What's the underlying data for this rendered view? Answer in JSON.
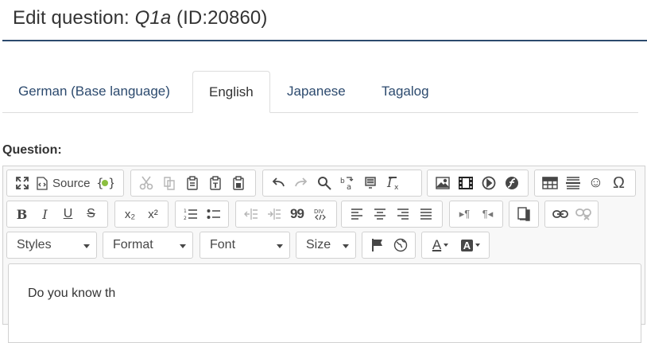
{
  "header": {
    "title_prefix": "Edit question: ",
    "question_code": "Q1a",
    "question_id": " (ID:20860)"
  },
  "tabs": [
    {
      "label": "German (Base language)",
      "active": false
    },
    {
      "label": "English",
      "active": true
    },
    {
      "label": "Japanese",
      "active": false
    },
    {
      "label": "Tagalog",
      "active": false
    }
  ],
  "question_label": "Question:",
  "editor": {
    "source_label": "Source",
    "combos": {
      "styles": "Styles",
      "format": "Format",
      "font": "Font",
      "size": "Size"
    },
    "glyphs": {
      "bold": "B",
      "italic": "I",
      "underline": "U",
      "strike": "S",
      "subscript": "x₂",
      "superscript": "x²",
      "blockquote": "99",
      "div": "DIV",
      "special_char": "Ω",
      "smiley": "☺",
      "ltr": "▸¶",
      "rtl": "¶◂",
      "text_color": "A",
      "bg_color": "A"
    },
    "content_text": "Do you know th"
  },
  "colors": {
    "accent": "#2c4a6e",
    "border": "#d1d1d1",
    "toolbar_bg": "#f8f8f8",
    "icon": "#474747",
    "icon_disabled": "#b6b6b6"
  }
}
